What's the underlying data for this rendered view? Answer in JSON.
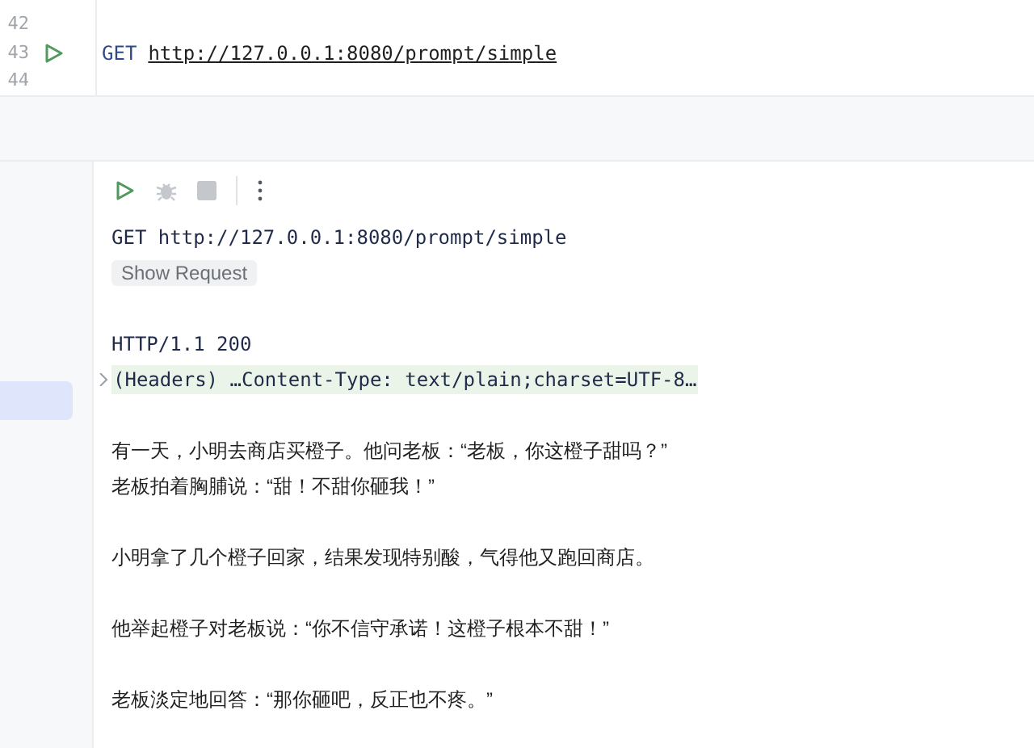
{
  "editor": {
    "lines": [
      {
        "number": "42"
      },
      {
        "number": "43",
        "runnable": true,
        "method": "GET",
        "url": "http://127.0.0.1:8080/prompt/simple"
      },
      {
        "number": "44"
      }
    ]
  },
  "sidebar": {
    "items": [
      {
        "selected": true
      }
    ]
  },
  "toolbar": [
    {
      "kind": "run",
      "disabled": false
    },
    {
      "kind": "debug",
      "disabled": true
    },
    {
      "kind": "stop",
      "disabled": true
    },
    {
      "kind": "more",
      "disabled": false
    }
  ],
  "response": {
    "request_line": "GET http://127.0.0.1:8080/prompt/simple",
    "show_request": "Show Request",
    "status_line": "HTTP/1.1 200",
    "headers": "(Headers) …Content-Type: text/plain;charset=UTF-8…",
    "headers_expanded": false,
    "paragraphs": [
      {
        "lines": [
          "有一天，小明去商店买橙子。他问老板：“老板，你这橙子甜吗？”",
          "老板拍着胸脯说：“甜！不甜你砸我！”"
        ]
      },
      {
        "lines": [
          "小明拿了几个橙子回家，结果发现特别酸，气得他又跑回商店。"
        ]
      },
      {
        "lines": [
          "他举起橙子对老板说：“你不信守承诺！这橙子根本不甜！”"
        ]
      },
      {
        "lines": [
          "老板淡定地回答：“那你砸吧，反正也不疼。”"
        ]
      }
    ]
  }
}
